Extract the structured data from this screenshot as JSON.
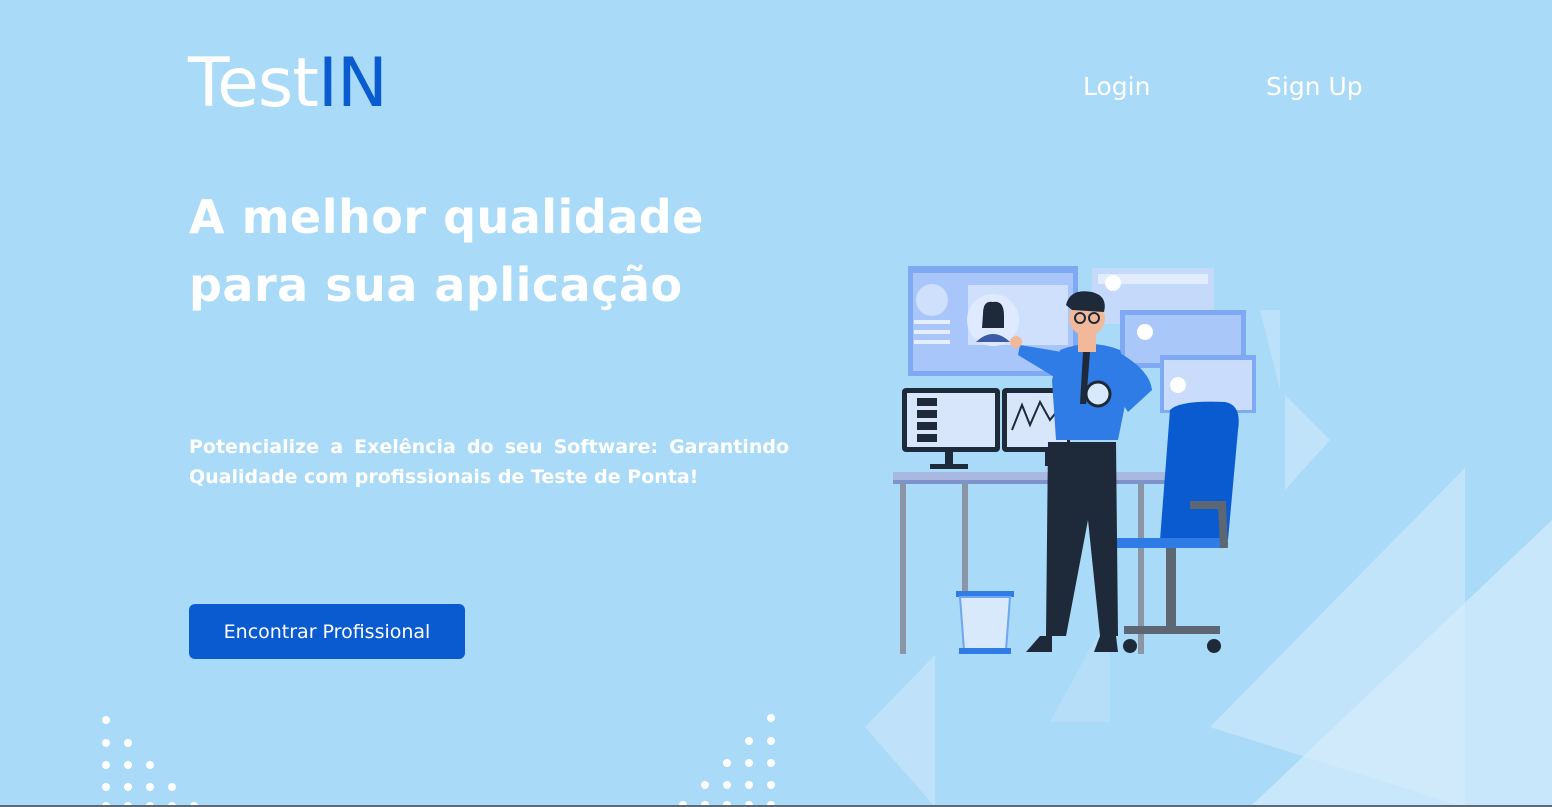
{
  "brand": {
    "name_main": "Test",
    "name_accent": "IN"
  },
  "nav": {
    "login": "Login",
    "signup": "Sign Up"
  },
  "hero": {
    "headline_line1": "A melhor qualidade",
    "headline_line2": "para sua aplicação",
    "subtitle": "Potencialize a Exelência do seu Software: Garantindo Qualidade com profissionais de Teste de Ponta!",
    "cta_label": "Encontrar Profissional"
  },
  "colors": {
    "background": "#a9daf7",
    "accent": "#0a5bd0",
    "text": "#ffffff"
  },
  "illustration": "tester-at-workstation-illustration"
}
